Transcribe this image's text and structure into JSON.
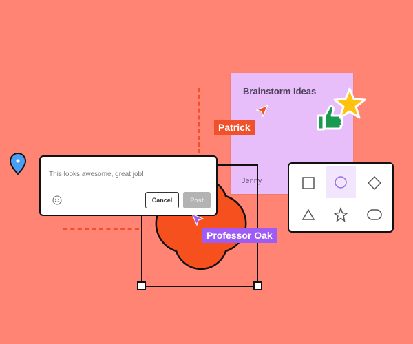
{
  "sticky_note": {
    "title": "Brainstorm Ideas",
    "author": "Jenny"
  },
  "cursors": [
    {
      "name": "Patrick",
      "color": "#f0502a"
    },
    {
      "name": "Professor Oak",
      "color": "#9f5cf5"
    }
  ],
  "comment": {
    "text": "This looks awesome, great job!",
    "cancel_label": "Cancel",
    "post_label": "Post"
  },
  "shape_picker": {
    "shapes": [
      "square",
      "circle",
      "diamond",
      "triangle",
      "star",
      "rounded-rectangle"
    ],
    "selected": "circle"
  },
  "colors": {
    "background": "#ff8474",
    "sticky": "#e8befa",
    "shape_fill": "#f5501e",
    "pin": "#4a9ff5"
  }
}
